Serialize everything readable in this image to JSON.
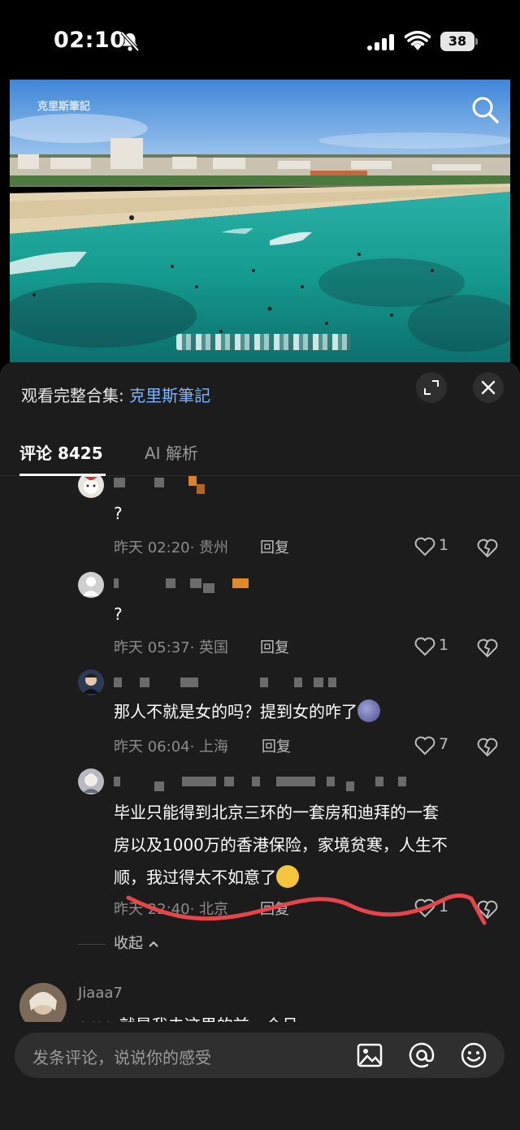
{
  "status_bar": {
    "time": "02:10",
    "battery": "38"
  },
  "video": {
    "watermark": "克里斯筆記"
  },
  "panel": {
    "collection_prefix": "观看完整合集: ",
    "collection_link": "克里斯筆記"
  },
  "tabs": [
    {
      "label": "评论 8425"
    },
    {
      "label": "AI 解析"
    }
  ],
  "comments": [
    {
      "text": "?",
      "time": "昨天 02:20",
      "location": "· 贵州",
      "reply": "回复",
      "likes": "1"
    },
    {
      "text": "?",
      "time": "昨天 05:37",
      "location": "· 英国",
      "reply": "回复",
      "likes": "1"
    },
    {
      "text": "那人不就是女的吗？提到女的咋了",
      "time": "昨天 06:04",
      "location": "· 上海",
      "reply": "回复",
      "likes": "7"
    },
    {
      "text_line1": "毕业只能得到北京三环的一套房和迪拜的一套",
      "text_line2": "房以及1000万的香港保险，家境贫寒，人生不",
      "text_line3": "顺，我过得太不如意了",
      "time": "昨天 22:40",
      "location": "· 北京",
      "reply": "回复",
      "likes": "1"
    }
  ],
  "collapse_label": "收起",
  "next_comment": {
    "user": "Jiaaa7",
    "text": "omg 就是我去这里的前一个月"
  },
  "input": {
    "placeholder": "发条评论，说说你的感受"
  },
  "colors": {
    "panel_bg": "#1c1c1c",
    "link": "#7fb4ff",
    "annotation_red": "#e8454a"
  }
}
